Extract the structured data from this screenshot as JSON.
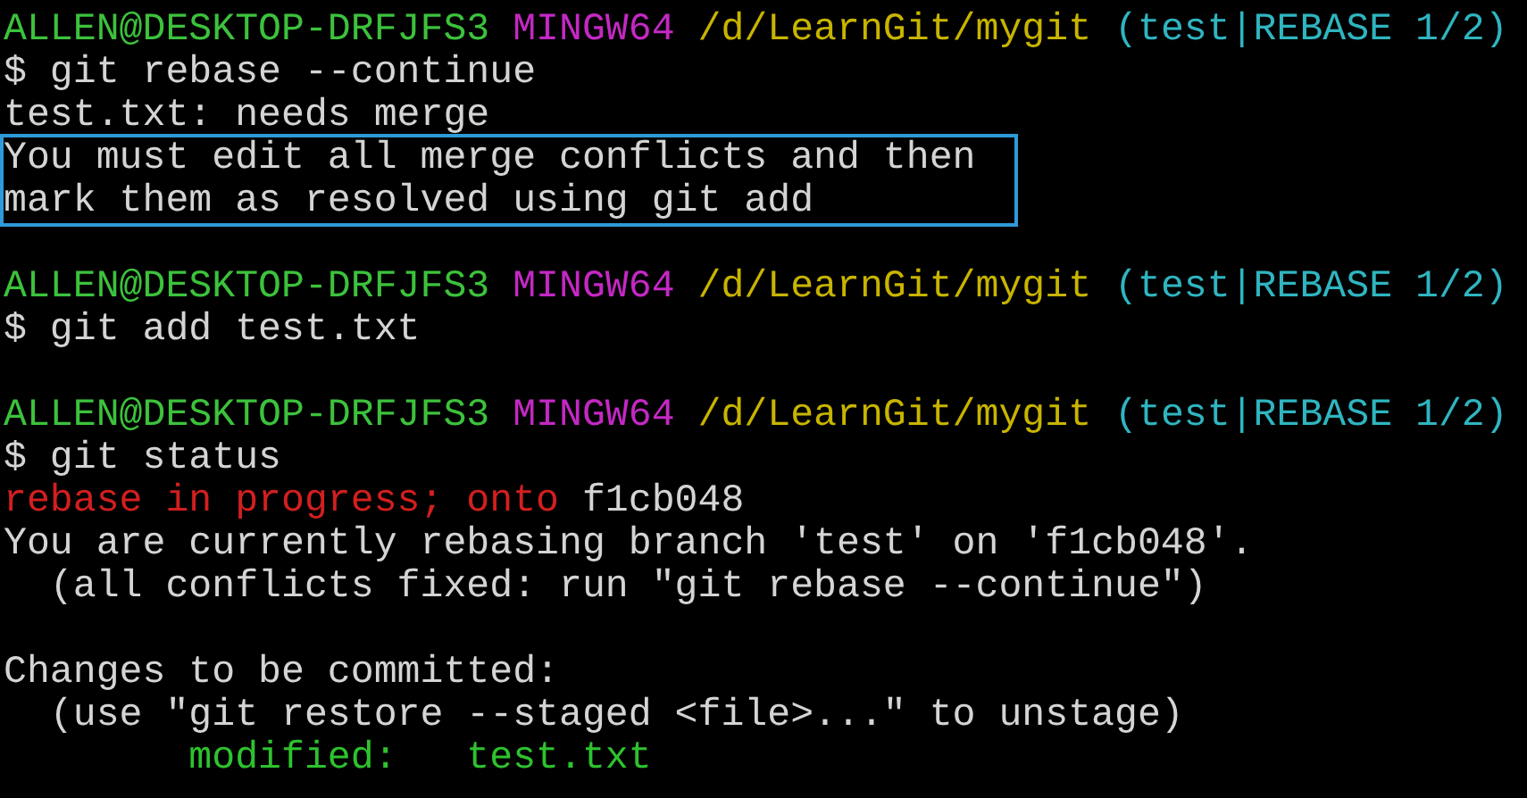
{
  "lines": [
    {
      "highlighted": false,
      "gap_before": false,
      "segments": [
        {
          "kind": "user",
          "text": "ALLEN@DESKTOP-DRFJFS3 "
        },
        {
          "kind": "system",
          "text": "MINGW64 "
        },
        {
          "kind": "path",
          "text": "/d/LearnGit/mygit "
        },
        {
          "kind": "branch",
          "text": "(test|REBASE 1/2)"
        }
      ]
    },
    {
      "highlighted": false,
      "gap_before": false,
      "segments": [
        {
          "kind": "command",
          "text": "$ git rebase --continue"
        }
      ]
    },
    {
      "highlighted": false,
      "gap_before": false,
      "segments": [
        {
          "kind": "output",
          "text": "test.txt: needs merge"
        }
      ]
    },
    {
      "highlighted": true,
      "gap_before": false,
      "segments": [
        {
          "kind": "output",
          "text": "You must edit all merge conflicts and then"
        }
      ]
    },
    {
      "highlighted": true,
      "gap_before": false,
      "segments": [
        {
          "kind": "output",
          "text": "mark them as resolved using git add"
        }
      ]
    },
    {
      "highlighted": false,
      "gap_before": true,
      "segments": [
        {
          "kind": "user",
          "text": "ALLEN@DESKTOP-DRFJFS3 "
        },
        {
          "kind": "system",
          "text": "MINGW64 "
        },
        {
          "kind": "path",
          "text": "/d/LearnGit/mygit "
        },
        {
          "kind": "branch",
          "text": "(test|REBASE 1/2)"
        }
      ]
    },
    {
      "highlighted": false,
      "gap_before": false,
      "segments": [
        {
          "kind": "command",
          "text": "$ git add test.txt"
        }
      ]
    },
    {
      "highlighted": false,
      "gap_before": true,
      "segments": [
        {
          "kind": "user",
          "text": "ALLEN@DESKTOP-DRFJFS3 "
        },
        {
          "kind": "system",
          "text": "MINGW64 "
        },
        {
          "kind": "path",
          "text": "/d/LearnGit/mygit "
        },
        {
          "kind": "branch",
          "text": "(test|REBASE 1/2)"
        }
      ]
    },
    {
      "highlighted": false,
      "gap_before": false,
      "segments": [
        {
          "kind": "command",
          "text": "$ git status"
        }
      ]
    },
    {
      "highlighted": false,
      "gap_before": false,
      "segments": [
        {
          "kind": "error",
          "text": "rebase in progress; onto"
        },
        {
          "kind": "output",
          "text": " f1cb048"
        }
      ]
    },
    {
      "highlighted": false,
      "gap_before": false,
      "segments": [
        {
          "kind": "output",
          "text": "You are currently rebasing branch 'test' on 'f1cb048'."
        }
      ]
    },
    {
      "highlighted": false,
      "gap_before": false,
      "segments": [
        {
          "kind": "output",
          "text": "  (all conflicts fixed: run \"git rebase --continue\")"
        }
      ]
    },
    {
      "highlighted": false,
      "gap_before": true,
      "segments": [
        {
          "kind": "output",
          "text": "Changes to be committed:"
        }
      ]
    },
    {
      "highlighted": false,
      "gap_before": false,
      "segments": [
        {
          "kind": "output",
          "text": "  (use \"git restore --staged <file>...\" to unstage)"
        }
      ]
    },
    {
      "highlighted": false,
      "gap_before": false,
      "indented": true,
      "segments": [
        {
          "kind": "staged",
          "text": "modified:   test.txt"
        }
      ]
    }
  ]
}
